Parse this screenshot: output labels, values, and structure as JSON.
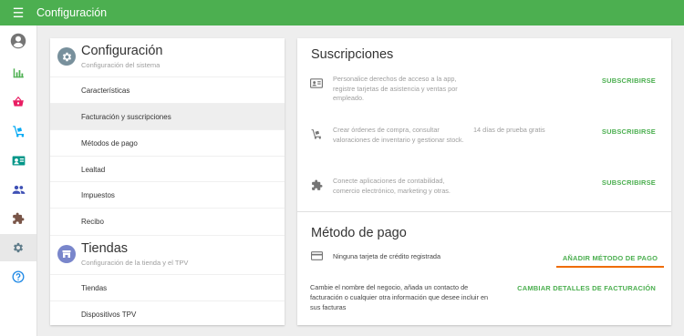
{
  "topbar": {
    "title": "Configuración",
    "menu_icon": "☰"
  },
  "rail": {
    "items": [
      {
        "name": "account",
        "icon": "account-circle-icon",
        "color": "#757575"
      },
      {
        "name": "reports",
        "icon": "bar-chart-icon",
        "color": "#4caf50"
      },
      {
        "name": "sales",
        "icon": "basket-icon",
        "color": "#e91e63"
      },
      {
        "name": "inventory",
        "icon": "dolly-icon",
        "color": "#03a9f4"
      },
      {
        "name": "employees",
        "icon": "badge-icon",
        "color": "#009688"
      },
      {
        "name": "customers",
        "icon": "people-icon",
        "color": "#3f51b5"
      },
      {
        "name": "integrations",
        "icon": "puzzle-icon",
        "color": "#795548"
      },
      {
        "name": "settings",
        "icon": "gear-icon",
        "color": "#607d8b",
        "active": true
      },
      {
        "name": "help",
        "icon": "help-icon",
        "color": "#1e88e5"
      }
    ]
  },
  "settings_panel": {
    "system": {
      "title": "Configuración",
      "subtitle": "Configuración del sistema",
      "items": [
        "Características",
        "Facturación y suscripciones",
        "Métodos de pago",
        "Lealtad",
        "Impuestos",
        "Recibo"
      ],
      "active_index": 1
    },
    "stores": {
      "title": "Tiendas",
      "subtitle": "Configuración de la tienda y el TPV",
      "items": [
        "Tiendas",
        "Dispositivos TPV"
      ]
    }
  },
  "subscriptions": {
    "title": "Suscripciones",
    "rows": [
      {
        "icon": "badge-icon",
        "text": "Personalice derechos de acceso a la app, registre tarjetas de asistencia y ventas por empleado.",
        "trial": "",
        "action": "SUBSCRIBIRSE"
      },
      {
        "icon": "dolly-icon",
        "text": "Crear órdenes de compra, consultar valoraciones de inventario y gestionar stock.",
        "trial": "14 días de prueba gratis",
        "action": "SUBSCRIBIRSE"
      },
      {
        "icon": "puzzle-icon",
        "text": "Conecte aplicaciones de contabilidad, comercio electrónico, marketing y otras.",
        "trial": "",
        "action": "SUBSCRIBIRSE"
      }
    ]
  },
  "payment": {
    "title": "Método de pago",
    "card_text": "Ninguna tarjeta de crédito registrada",
    "add_action": "AÑADIR MÉTODO DE PAGO",
    "billing_text": "Cambie el nombre del negocio, añada un contacto de facturación o cualquier otra información que desee incluir en sus facturas",
    "billing_action": "CAMBIAR DETALLES DE FACTURACIÓN"
  },
  "colors": {
    "primary": "#4caf50",
    "accent": "#ef6c00"
  }
}
